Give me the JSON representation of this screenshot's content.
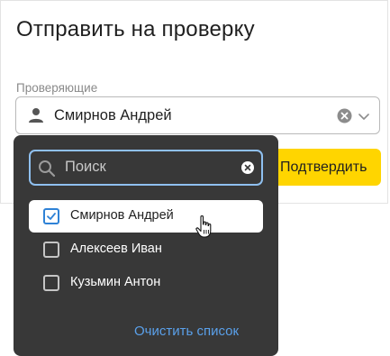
{
  "dialog": {
    "title": "Отправить на проверку",
    "field_label": "Проверяющие",
    "selected_value": "Смирнов Андрей",
    "confirm_label": "Подтвердить"
  },
  "dropdown": {
    "search_placeholder": "Поиск",
    "options": [
      {
        "label": "Смирнов Андрей",
        "checked": true
      },
      {
        "label": "Алексеев Иван",
        "checked": false
      },
      {
        "label": "Кузьмин Антон",
        "checked": false
      }
    ],
    "clear_list_label": "Очистить список"
  },
  "colors": {
    "accent_yellow": "#ffd500",
    "dropdown_bg": "#383838",
    "link_blue": "#5aa0ea",
    "focus_blue": "#8fc0f0"
  },
  "icons": [
    "person-icon",
    "clear-icon",
    "chevron-down-icon",
    "search-icon",
    "search-clear-icon",
    "check-icon",
    "hand-cursor-icon"
  ]
}
